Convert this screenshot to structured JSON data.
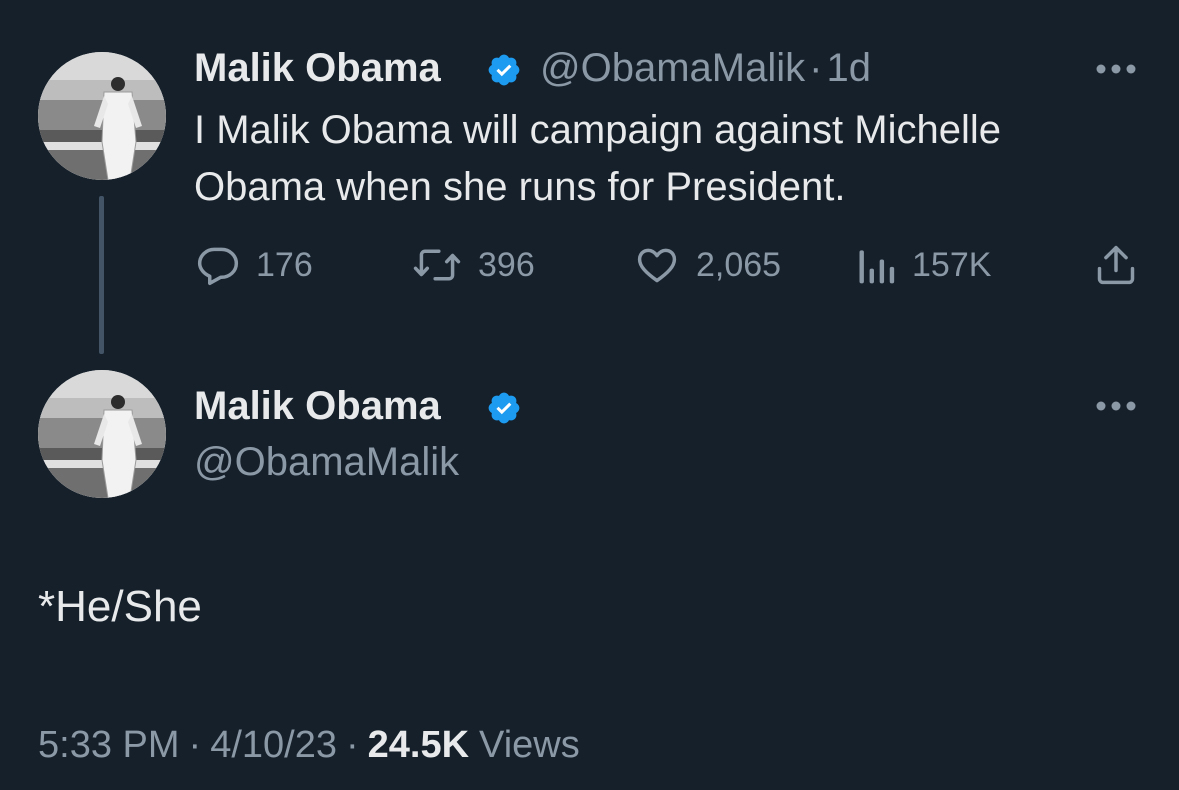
{
  "reply_tweet": {
    "author_name": "Malik Obama",
    "handle": "@ObamaMalik",
    "separator": "·",
    "time_ago": "1d",
    "text_line1": "I Malik Obama will campaign against Michelle",
    "text_line2": "Obama when she runs for President.",
    "actions": {
      "replies": "176",
      "retweets": "396",
      "likes": "2,065",
      "views": "157K"
    }
  },
  "main_tweet": {
    "author_name": "Malik Obama",
    "handle": "@ObamaMalik",
    "text": "*He/She",
    "time": "5:33 PM",
    "sep1": "·",
    "date": "4/10/23",
    "sep2": "·",
    "views_count": "24.5K",
    "views_label": "Views"
  },
  "colors": {
    "background": "#15202b",
    "primary_text": "#e7e9ea",
    "secondary_text": "#8b98a5",
    "verified_blue": "#1d9bf0",
    "thread_line": "#425466"
  },
  "icons": [
    "verified-badge-icon",
    "more-options-icon",
    "reply-icon",
    "retweet-icon",
    "like-icon",
    "views-icon",
    "share-icon"
  ]
}
